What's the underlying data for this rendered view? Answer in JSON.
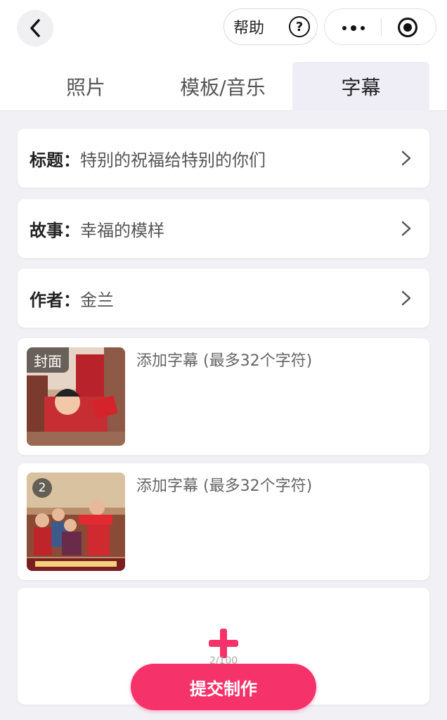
{
  "header": {
    "help_label": "帮助",
    "help_glyph": "?"
  },
  "tabs": [
    {
      "label": "照片",
      "active": false
    },
    {
      "label": "模板/音乐",
      "active": false
    },
    {
      "label": "字幕",
      "active": true
    }
  ],
  "fields": [
    {
      "label": "标题：",
      "value": "特别的祝福给特别的你们"
    },
    {
      "label": "故事：",
      "value": "幸福的模样"
    },
    {
      "label": "作者：",
      "value": "金兰"
    }
  ],
  "captions": [
    {
      "badge": "封面",
      "placeholder": "添加字幕 (最多32个字符)"
    },
    {
      "badge": "2",
      "placeholder": "添加字幕 (最多32个字符)"
    }
  ],
  "add": {
    "counter": "2/100"
  },
  "submit_label": "提交制作",
  "colors": {
    "accent": "#f5336a",
    "background": "#f1f0f5",
    "active_tab": "#efeef6"
  }
}
